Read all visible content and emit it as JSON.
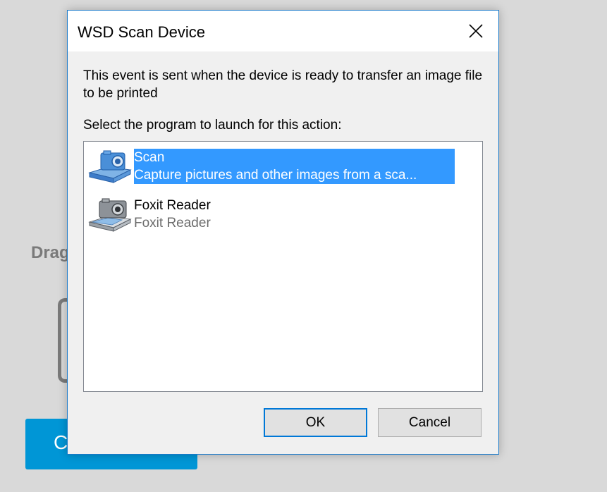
{
  "background": {
    "drag_text": "Drag",
    "button_text": "C"
  },
  "dialog": {
    "title": "WSD Scan Device",
    "description": "This event is sent when the device is ready to transfer an image file to be printed",
    "prompt": "Select the program to launch for this action:",
    "programs": [
      {
        "name": "Scan",
        "subtitle": "Capture pictures and other images from a sca...",
        "selected": true,
        "icon": "scanner-camera-icon"
      },
      {
        "name": "Foxit Reader",
        "subtitle": "Foxit Reader",
        "selected": false,
        "icon": "camera-document-icon"
      }
    ],
    "ok_label": "OK",
    "cancel_label": "Cancel"
  },
  "colors": {
    "selection": "#3399ff",
    "accent_border": "#0078d7",
    "background_button": "#0096d6"
  }
}
